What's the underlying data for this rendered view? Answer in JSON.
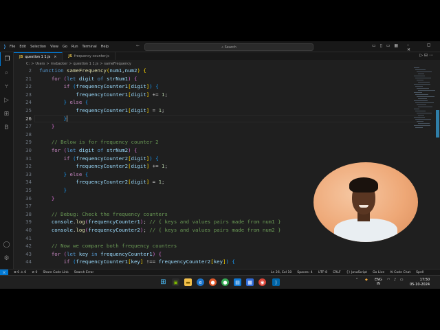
{
  "title_bar": {
    "menu": [
      "File",
      "Edit",
      "Selection",
      "View",
      "Go",
      "Run",
      "Terminal",
      "Help"
    ],
    "search_placeholder": "Search"
  },
  "tabs": [
    {
      "label": "question 1 1.js",
      "icon": "JS",
      "active": true,
      "close": "×"
    },
    {
      "label": "frequency counter.js",
      "icon": "JS",
      "active": false,
      "close": ""
    }
  ],
  "breadcrumb": [
    "C:",
    ">",
    "Users",
    ">",
    "mvbacker",
    ">",
    "question 1 1.js",
    ">",
    "sameFrequency"
  ],
  "code_lines": [
    {
      "n": "2",
      "tokens": [
        [
          "kw",
          "function "
        ],
        [
          "fn",
          "sameFrequency"
        ],
        [
          "br1",
          "("
        ],
        [
          "var",
          "num1"
        ],
        [
          "",
          ","
        ],
        [
          "var",
          "num2"
        ],
        [
          "br1",
          ")"
        ],
        [
          "",
          " "
        ],
        [
          "br1",
          "{"
        ]
      ]
    },
    {
      "n": "21",
      "tokens": [
        [
          "",
          "    "
        ],
        [
          "ctl",
          "for"
        ],
        [
          "",
          " "
        ],
        [
          "br2",
          "("
        ],
        [
          "kw",
          "let"
        ],
        [
          "",
          " "
        ],
        [
          "var",
          "digit"
        ],
        [
          "",
          " "
        ],
        [
          "kw",
          "of"
        ],
        [
          "",
          " "
        ],
        [
          "var",
          "strNum1"
        ],
        [
          "br2",
          ")"
        ],
        [
          "",
          " "
        ],
        [
          "br2",
          "{"
        ]
      ]
    },
    {
      "n": "22",
      "tokens": [
        [
          "",
          "        "
        ],
        [
          "ctl",
          "if"
        ],
        [
          "",
          " "
        ],
        [
          "br3",
          "("
        ],
        [
          "var",
          "frequencyCounter1"
        ],
        [
          "br1",
          "["
        ],
        [
          "var",
          "digit"
        ],
        [
          "br1",
          "]"
        ],
        [
          "br3",
          ")"
        ],
        [
          "",
          " "
        ],
        [
          "br3",
          "{"
        ]
      ]
    },
    {
      "n": "23",
      "tokens": [
        [
          "",
          "            "
        ],
        [
          "var",
          "frequencyCounter1"
        ],
        [
          "br1",
          "["
        ],
        [
          "var",
          "digit"
        ],
        [
          "br1",
          "]"
        ],
        [
          "",
          " += "
        ],
        [
          "num",
          "1"
        ],
        [
          "",
          ";"
        ]
      ]
    },
    {
      "n": "24",
      "tokens": [
        [
          "",
          "        "
        ],
        [
          "br3",
          "}"
        ],
        [
          "",
          " "
        ],
        [
          "ctl",
          "else"
        ],
        [
          "",
          " "
        ],
        [
          "br3",
          "{"
        ]
      ]
    },
    {
      "n": "25",
      "tokens": [
        [
          "",
          "            "
        ],
        [
          "var",
          "frequencyCounter1"
        ],
        [
          "br1",
          "["
        ],
        [
          "var",
          "digit"
        ],
        [
          "br1",
          "]"
        ],
        [
          "",
          " = "
        ],
        [
          "num",
          "1"
        ],
        [
          "",
          ";"
        ]
      ]
    },
    {
      "n": "26",
      "tokens": [
        [
          "",
          "        "
        ],
        [
          "br3",
          "}"
        ]
      ],
      "current": true
    },
    {
      "n": "27",
      "tokens": [
        [
          "",
          "    "
        ],
        [
          "br2",
          "}"
        ]
      ]
    },
    {
      "n": "28",
      "tokens": []
    },
    {
      "n": "29",
      "tokens": [
        [
          "",
          "    "
        ],
        [
          "cm",
          "// Below is for frequency counter 2"
        ]
      ]
    },
    {
      "n": "30",
      "tokens": [
        [
          "",
          "    "
        ],
        [
          "ctl",
          "for"
        ],
        [
          "",
          " "
        ],
        [
          "br2",
          "("
        ],
        [
          "kw",
          "let"
        ],
        [
          "",
          " "
        ],
        [
          "var",
          "digit"
        ],
        [
          "",
          " "
        ],
        [
          "kw",
          "of"
        ],
        [
          "",
          " "
        ],
        [
          "var",
          "strNum2"
        ],
        [
          "br2",
          ")"
        ],
        [
          "",
          " "
        ],
        [
          "br2",
          "{"
        ]
      ]
    },
    {
      "n": "31",
      "tokens": [
        [
          "",
          "        "
        ],
        [
          "ctl",
          "if"
        ],
        [
          "",
          " "
        ],
        [
          "br3",
          "("
        ],
        [
          "var",
          "frequencyCounter2"
        ],
        [
          "br1",
          "["
        ],
        [
          "var",
          "digit"
        ],
        [
          "br1",
          "]"
        ],
        [
          "br3",
          ")"
        ],
        [
          "",
          " "
        ],
        [
          "br3",
          "{"
        ]
      ]
    },
    {
      "n": "32",
      "tokens": [
        [
          "",
          "            "
        ],
        [
          "var",
          "frequencyCounter2"
        ],
        [
          "br1",
          "["
        ],
        [
          "var",
          "digit"
        ],
        [
          "br1",
          "]"
        ],
        [
          "",
          " += "
        ],
        [
          "num",
          "1"
        ],
        [
          "",
          ";"
        ]
      ]
    },
    {
      "n": "33",
      "tokens": [
        [
          "",
          "        "
        ],
        [
          "br3",
          "}"
        ],
        [
          "",
          " "
        ],
        [
          "ctl",
          "else"
        ],
        [
          "",
          " "
        ],
        [
          "br3",
          "{"
        ]
      ]
    },
    {
      "n": "34",
      "tokens": [
        [
          "",
          "            "
        ],
        [
          "var",
          "frequencyCounter2"
        ],
        [
          "br1",
          "["
        ],
        [
          "var",
          "digit"
        ],
        [
          "br1",
          "]"
        ],
        [
          "",
          " = "
        ],
        [
          "num",
          "1"
        ],
        [
          "",
          ";"
        ]
      ]
    },
    {
      "n": "35",
      "tokens": [
        [
          "",
          "        "
        ],
        [
          "br3",
          "}"
        ]
      ]
    },
    {
      "n": "36",
      "tokens": [
        [
          "",
          "    "
        ],
        [
          "br2",
          "}"
        ]
      ]
    },
    {
      "n": "37",
      "tokens": []
    },
    {
      "n": "38",
      "tokens": [
        [
          "",
          "    "
        ],
        [
          "cm",
          "// Debug: Check the frequency counters"
        ]
      ]
    },
    {
      "n": "39",
      "tokens": [
        [
          "",
          "    "
        ],
        [
          "var",
          "console"
        ],
        [
          "",
          "."
        ],
        [
          "fn",
          "log"
        ],
        [
          "br2",
          "("
        ],
        [
          "var",
          "frequencyCounter1"
        ],
        [
          "br2",
          ")"
        ],
        [
          "",
          ";"
        ],
        [
          "",
          " "
        ],
        [
          "cm",
          "// { keys and values pairs made from num1 }"
        ]
      ]
    },
    {
      "n": "40",
      "tokens": [
        [
          "",
          "    "
        ],
        [
          "var",
          "console"
        ],
        [
          "",
          "."
        ],
        [
          "fn",
          "log"
        ],
        [
          "br2",
          "("
        ],
        [
          "var",
          "frequencyCounter2"
        ],
        [
          "br2",
          ")"
        ],
        [
          "",
          ";"
        ],
        [
          "",
          " "
        ],
        [
          "cm",
          "// { keys and values pairs made from num2 }"
        ]
      ]
    },
    {
      "n": "41",
      "tokens": []
    },
    {
      "n": "42",
      "tokens": [
        [
          "",
          "    "
        ],
        [
          "cm",
          "// Now we compare both frequency counters"
        ]
      ]
    },
    {
      "n": "43",
      "tokens": [
        [
          "",
          "    "
        ],
        [
          "ctl",
          "for"
        ],
        [
          "",
          " "
        ],
        [
          "br2",
          "("
        ],
        [
          "kw",
          "let"
        ],
        [
          "",
          " "
        ],
        [
          "var",
          "key"
        ],
        [
          "",
          " "
        ],
        [
          "kw",
          "in"
        ],
        [
          "",
          " "
        ],
        [
          "var",
          "frequencyCounter1"
        ],
        [
          "br2",
          ")"
        ],
        [
          "",
          " "
        ],
        [
          "br2",
          "{"
        ]
      ]
    },
    {
      "n": "44",
      "tokens": [
        [
          "",
          "        "
        ],
        [
          "ctl",
          "if"
        ],
        [
          "",
          " "
        ],
        [
          "br3",
          "("
        ],
        [
          "var",
          "frequencyCounter1"
        ],
        [
          "br1",
          "["
        ],
        [
          "var",
          "key"
        ],
        [
          "br1",
          "]"
        ],
        [
          "",
          " !== "
        ],
        [
          "var",
          "frequencyCounter2"
        ],
        [
          "br1",
          "["
        ],
        [
          "var",
          "key"
        ],
        [
          "br1",
          "]"
        ],
        [
          "br3",
          ")"
        ],
        [
          "",
          " "
        ],
        [
          "br3",
          "{"
        ]
      ]
    }
  ],
  "status_bar": {
    "left": [
      "⊗ 0 ⚠ 0",
      "⊘ 0",
      "Share Code Link",
      "Search Error"
    ],
    "right": [
      "Ln 26, Col 10",
      "Spaces: 4",
      "UTF-8",
      "CRLF",
      "{} JavaScript",
      "Go Live",
      "AI Code Chat",
      "Spell"
    ]
  },
  "taskbar": {
    "lang": "ENG",
    "lang2": "IN",
    "time": "17:50",
    "date": "05-10-2024"
  },
  "icons": {
    "activity": [
      "files-icon",
      "search-icon",
      "source-control-icon",
      "run-debug-icon",
      "extensions-icon",
      "remote-icon",
      "account-icon",
      "settings-icon"
    ]
  }
}
